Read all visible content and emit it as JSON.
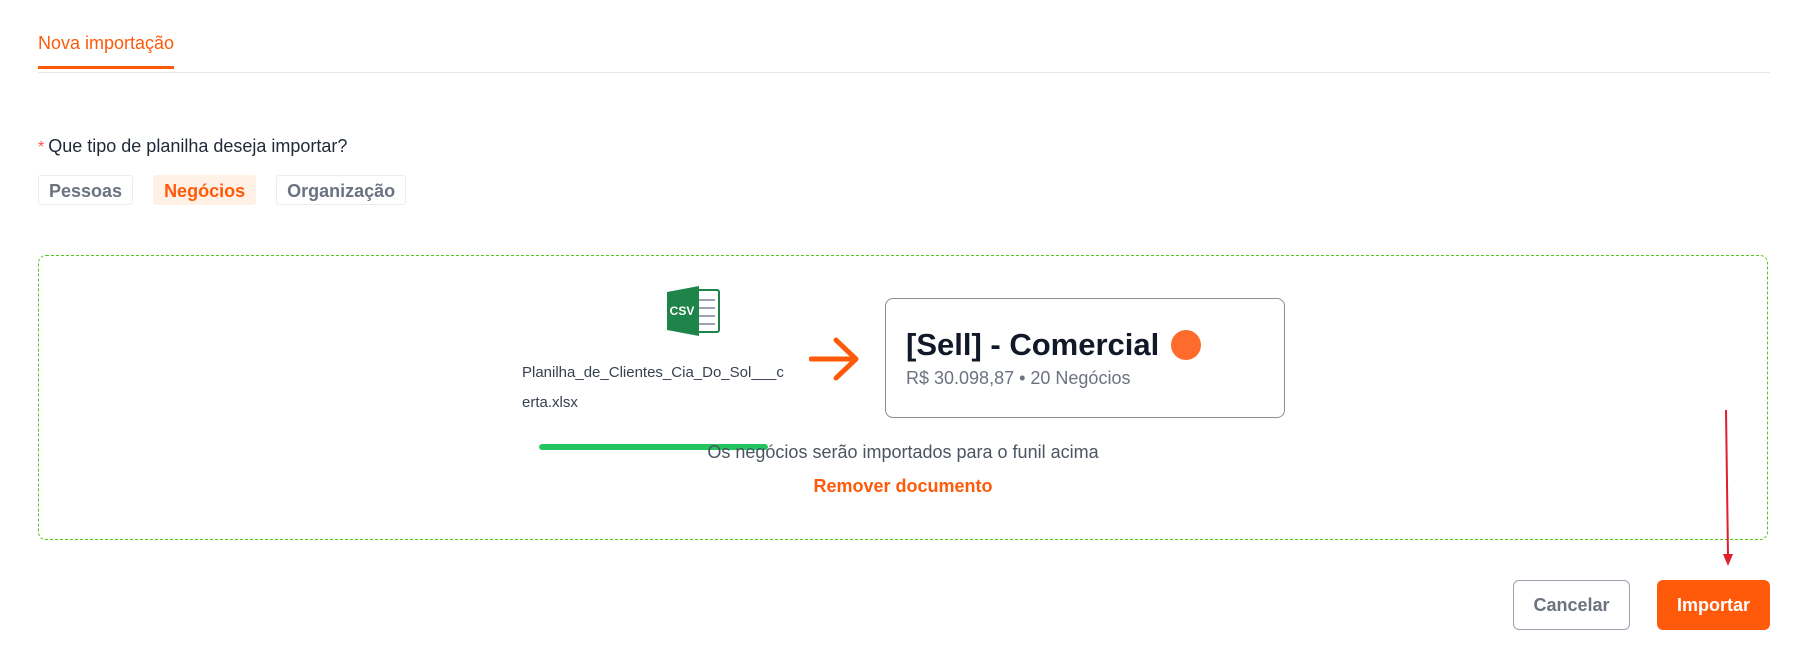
{
  "tabs": {
    "active_label": "Nova importação"
  },
  "question": {
    "required_mark": "*",
    "label": "Que tipo de planilha deseja importar?",
    "options": [
      {
        "label": "Pessoas",
        "selected": false
      },
      {
        "label": "Negócios",
        "selected": true
      },
      {
        "label": "Organização",
        "selected": false
      }
    ]
  },
  "upload": {
    "file_icon": "csv-file-icon",
    "file_icon_label": "CSV",
    "file_name": "Planilha_de_Clientes_Cia_Do_Sol___certa.xlsx",
    "progress": 1.0,
    "arrow_icon": "arrow-right-icon",
    "funnel": {
      "title": "[Sell] - Comercial",
      "dot_color": "#ff6b2c",
      "summary": "R$ 30.098,87 • 20 Negócios"
    },
    "info_text": "Os negócios serão importados para o funil acima",
    "remove_label": "Remover documento"
  },
  "footer": {
    "cancel_label": "Cancelar",
    "import_label": "Importar"
  },
  "colors": {
    "accent": "#ff5a0a",
    "dropzone_border": "#52c41a",
    "progress": "#22c55e",
    "annotation": "#e11d2e"
  }
}
